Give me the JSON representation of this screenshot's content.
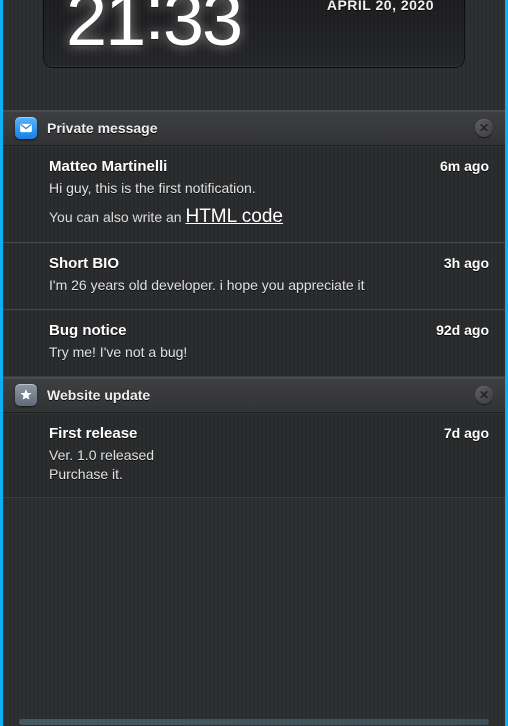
{
  "clock": {
    "hours": "21",
    "minutes": "33",
    "date_line": "APRIL 20, 2020"
  },
  "groups": [
    {
      "id": "pm",
      "icon": "mail-icon",
      "icon_bg": "linear-gradient(to bottom,#55b6ff,#1a7fe0)",
      "title": "Private message",
      "items": [
        {
          "title": "Matteo Martinelli",
          "time": "6m ago",
          "body": "Hi guy, this is the first notification.",
          "extra_prefix": "You can also write an ",
          "extra_link": "HTML code"
        },
        {
          "title": "Short BIO",
          "time": "3h ago",
          "body": "I'm 26 years old developer. i hope you appreciate it"
        },
        {
          "title": "Bug notice",
          "time": "92d ago",
          "body": "Try me! I've not a bug!"
        }
      ]
    },
    {
      "id": "site",
      "icon": "star-icon",
      "icon_bg": "linear-gradient(to bottom,#8d99a6,#5f6a75)",
      "title": "Website update",
      "items": [
        {
          "title": "First release",
          "time": "7d ago",
          "body": "Ver. 1.0 released\nPurchase it."
        }
      ]
    }
  ]
}
